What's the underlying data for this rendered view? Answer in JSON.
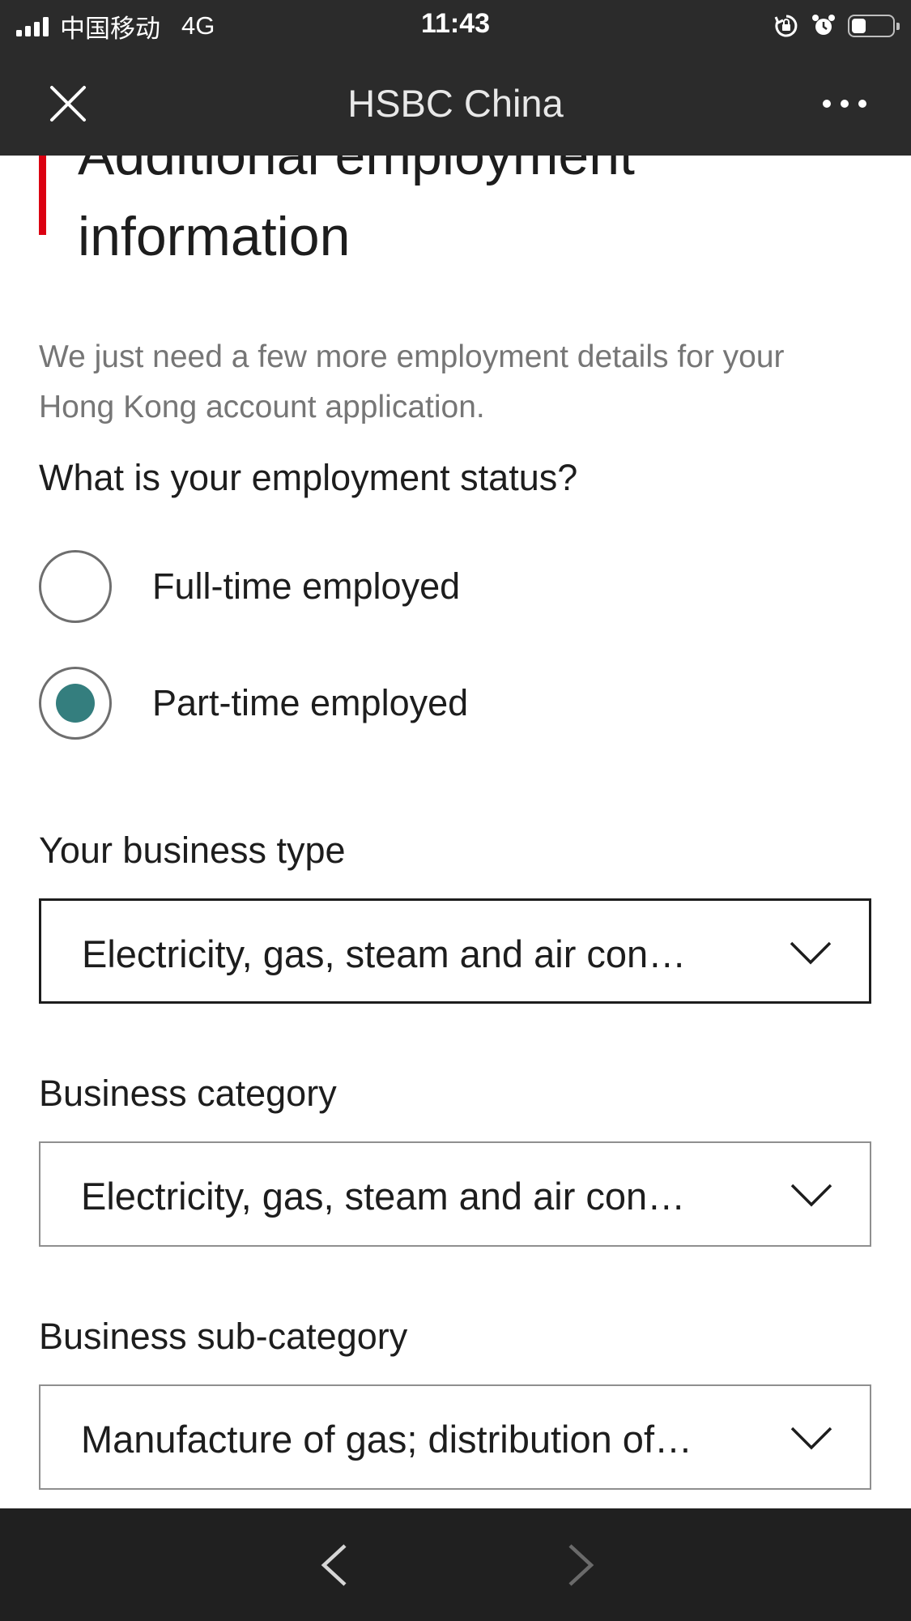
{
  "status_bar": {
    "carrier": "中国移动",
    "network": "4G",
    "time": "11:43",
    "icons": [
      "signal-icon",
      "orientation-lock-icon",
      "alarm-icon",
      "battery-icon"
    ],
    "battery_level": 0.35
  },
  "nav": {
    "title": "HSBC China",
    "close_icon": "close-icon",
    "more_icon": "more-icon"
  },
  "page": {
    "heading": "Additional employment information",
    "intro": "We just need a few more employment details for your Hong Kong account application.",
    "question": "What is your employment status?",
    "options": [
      {
        "label": "Full-time employed",
        "selected": false
      },
      {
        "label": "Part-time employed",
        "selected": true
      }
    ],
    "fields": [
      {
        "label": "Your business type",
        "value": "Electricity, gas, steam and air con…"
      },
      {
        "label": "Business category",
        "value": "Electricity, gas, steam and air con…"
      },
      {
        "label": "Business sub-category",
        "value": "Manufacture of gas; distribution of…"
      }
    ]
  },
  "toolbar": {
    "back_icon": "chevron-left-icon",
    "forward_icon": "chevron-right-icon",
    "forward_enabled": false
  },
  "colors": {
    "accent_red": "#db0011",
    "radio_selected": "#347e7e",
    "header_bg": "#2b2b2b",
    "bottom_bg": "#202020",
    "muted_text": "#767676"
  }
}
